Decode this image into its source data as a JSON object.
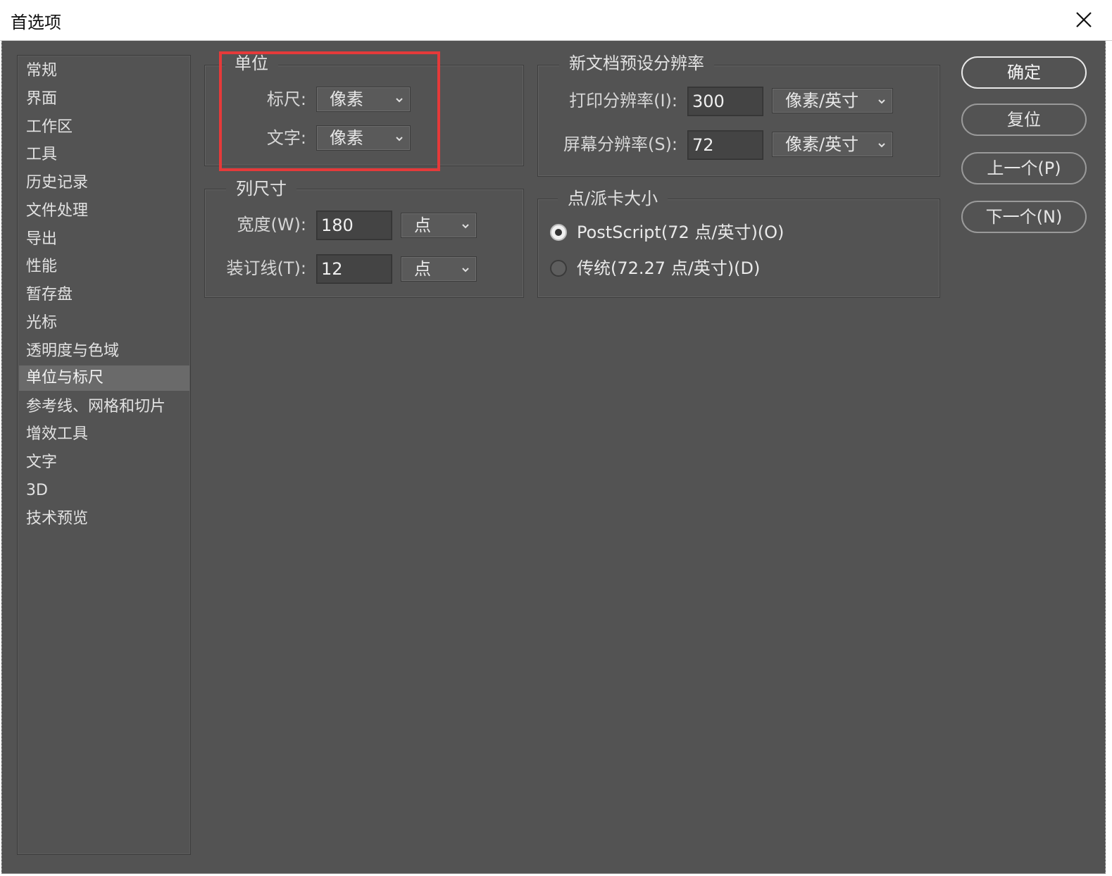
{
  "window": {
    "title": "首选项"
  },
  "sidebar": {
    "items": [
      {
        "label": "常规"
      },
      {
        "label": "界面"
      },
      {
        "label": "工作区"
      },
      {
        "label": "工具"
      },
      {
        "label": "历史记录"
      },
      {
        "label": "文件处理"
      },
      {
        "label": "导出"
      },
      {
        "label": "性能"
      },
      {
        "label": "暂存盘"
      },
      {
        "label": "光标"
      },
      {
        "label": "透明度与色域"
      },
      {
        "label": "单位与标尺"
      },
      {
        "label": "参考线、网格和切片"
      },
      {
        "label": "增效工具"
      },
      {
        "label": "文字"
      },
      {
        "label": "3D"
      },
      {
        "label": "技术预览"
      }
    ],
    "selected": "单位与标尺"
  },
  "units": {
    "title": "单位",
    "ruler_label": "标尺:",
    "ruler_value": "像素",
    "type_label": "文字:",
    "type_value": "像素"
  },
  "column_size": {
    "title": "列尺寸",
    "width_label": "宽度(W):",
    "width_value": "180",
    "width_unit": "点",
    "gutter_label": "装订线(T):",
    "gutter_value": "12",
    "gutter_unit": "点"
  },
  "new_doc_resolution": {
    "title": "新文档预设分辨率",
    "print_label": "打印分辨率(I):",
    "print_value": "300",
    "print_unit": "像素/英寸",
    "screen_label": "屏幕分辨率(S):",
    "screen_value": "72",
    "screen_unit": "像素/英寸"
  },
  "point_size": {
    "title": "点/派卡大小",
    "option_postscript": "PostScript(72 点/英寸)(O)",
    "option_traditional": "传统(72.27 点/英寸)(D)",
    "selected": "PostScript(72 点/英寸)(O)"
  },
  "buttons": {
    "ok": "确定",
    "reset": "复位",
    "prev": "上一个(P)",
    "next": "下一个(N)"
  },
  "colors": {
    "dialog_bg": "#535353",
    "highlight": "#e53a3a",
    "selected_item": "#6a6a6a"
  }
}
